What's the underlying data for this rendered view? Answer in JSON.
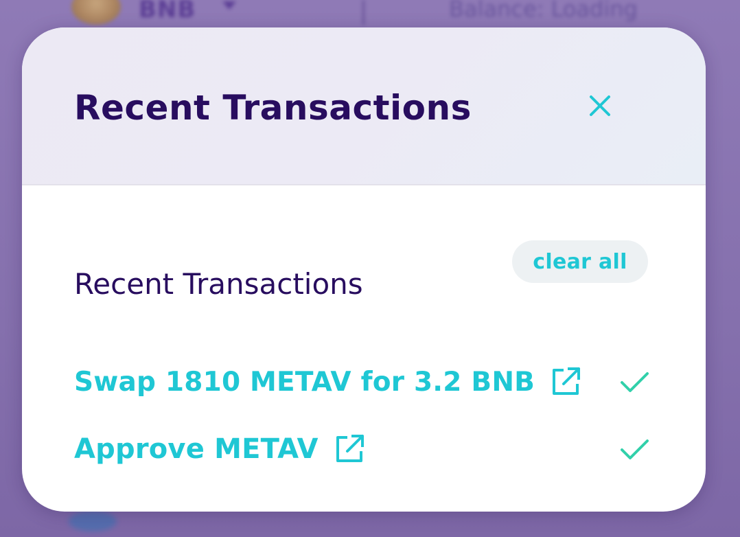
{
  "background": {
    "token_symbol": "BNB",
    "balance_text": "Balance: Loading"
  },
  "modal": {
    "title": "Recent Transactions",
    "close_icon": "close-icon",
    "section_title": "Recent Transactions",
    "clear_all_label": "clear all",
    "transactions": [
      {
        "label": "Swap 1810 METAV for 3.2 BNB",
        "status": "confirmed",
        "icon": "external-link-icon"
      },
      {
        "label": "Approve METAV",
        "status": "confirmed",
        "icon": "external-link-icon"
      }
    ]
  },
  "colors": {
    "title_text": "#280d5f",
    "accent": "#1fc7d4",
    "success": "#31d0aa",
    "header_bg": "#eceaf5",
    "chip_bg": "#edf1f3",
    "backdrop": "#8a72b0"
  }
}
